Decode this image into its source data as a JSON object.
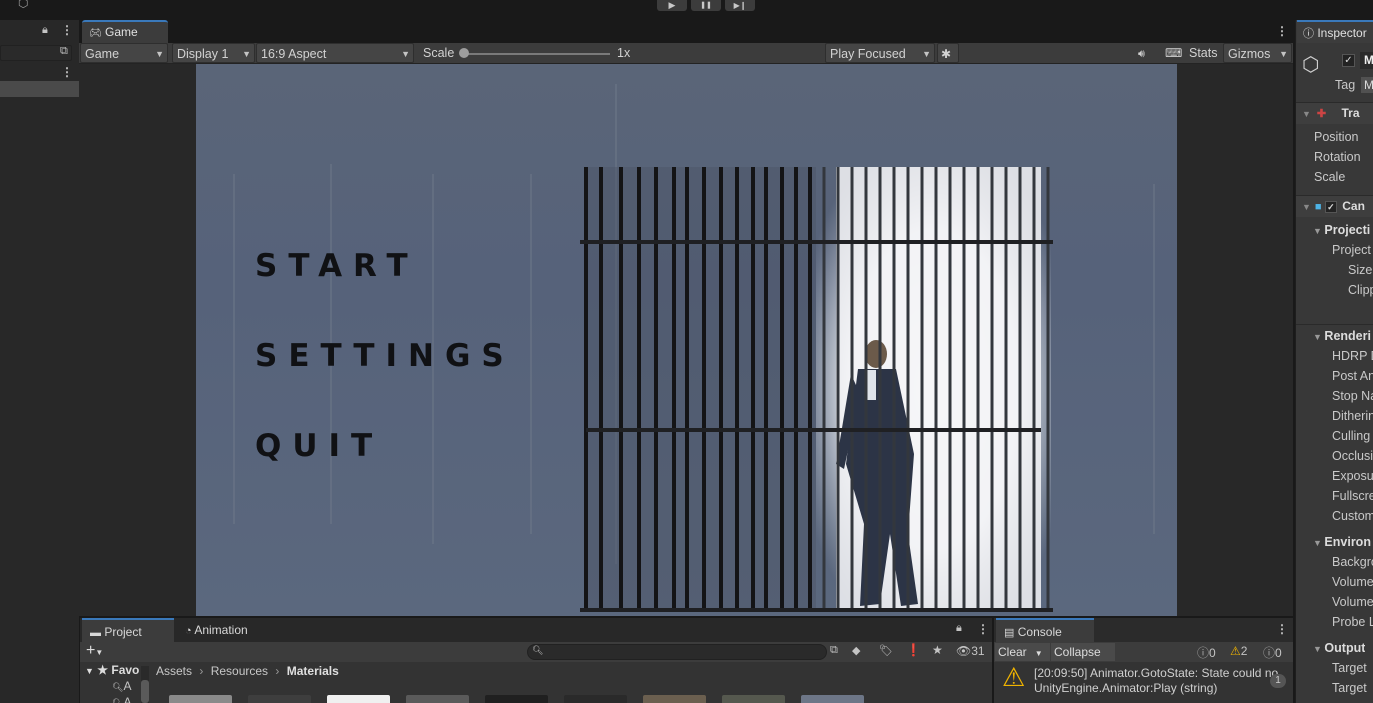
{
  "topbar": {
    "play": "▶",
    "pause": "❚❚",
    "step": "▶❙"
  },
  "game": {
    "tab_label": "Game",
    "toolbar": {
      "view_select": "Game",
      "display": "Display 1",
      "aspect": "16:9 Aspect",
      "scale_label": "Scale",
      "scale_value": "1x",
      "scale_level": 0.0,
      "play_mode": "Play Focused",
      "stats": "Stats",
      "gizmos": "Gizmos"
    },
    "menu": {
      "start": "START",
      "settings": "SETTINGS",
      "quit": "QUIT"
    }
  },
  "inspector": {
    "tab_label": "Inspector",
    "object_name": "M",
    "tag_label": "Tag",
    "tag_value": "M",
    "transform": {
      "header": "Tra",
      "rows": [
        "Position",
        "Rotation",
        "Scale"
      ]
    },
    "camera": {
      "header": "Can",
      "sections": [
        {
          "title": "Projecti",
          "rows": [
            "Project",
            "Size",
            "Clipp"
          ]
        },
        {
          "title": "Renderi",
          "rows": [
            "HDRP D",
            "Post An",
            "Stop Na",
            "Ditherin",
            "Culling",
            "Occlusi",
            "Exposu",
            "Fullscre",
            "Custom"
          ]
        },
        {
          "title": "Environ",
          "rows": [
            "Backgro",
            "Volume",
            "Volume",
            "Probe L"
          ]
        },
        {
          "title": "Output",
          "rows": [
            "Target",
            "Target"
          ]
        }
      ]
    }
  },
  "project": {
    "tabs": [
      "Project",
      "Animation"
    ],
    "search_placeholder": "",
    "hidden_count": "31",
    "breadcrumb": [
      "Assets",
      "Resources",
      "Materials"
    ],
    "favorites_label": "Favo",
    "tree_items": [
      "A",
      "A"
    ]
  },
  "console": {
    "tab_label": "Console",
    "clear": "Clear",
    "collapse": "Collapse",
    "info_count": "0",
    "warn_count": "2",
    "error_count": "0",
    "log_line1": "[20:09:50] Animator.GotoState: State could no",
    "log_line2": "UnityEngine.Animator:Play (string)",
    "log_count": "1"
  },
  "colors": {
    "accent": "#3a79bb",
    "warning": "#f0b400",
    "scene_bg": "#5a6578"
  }
}
